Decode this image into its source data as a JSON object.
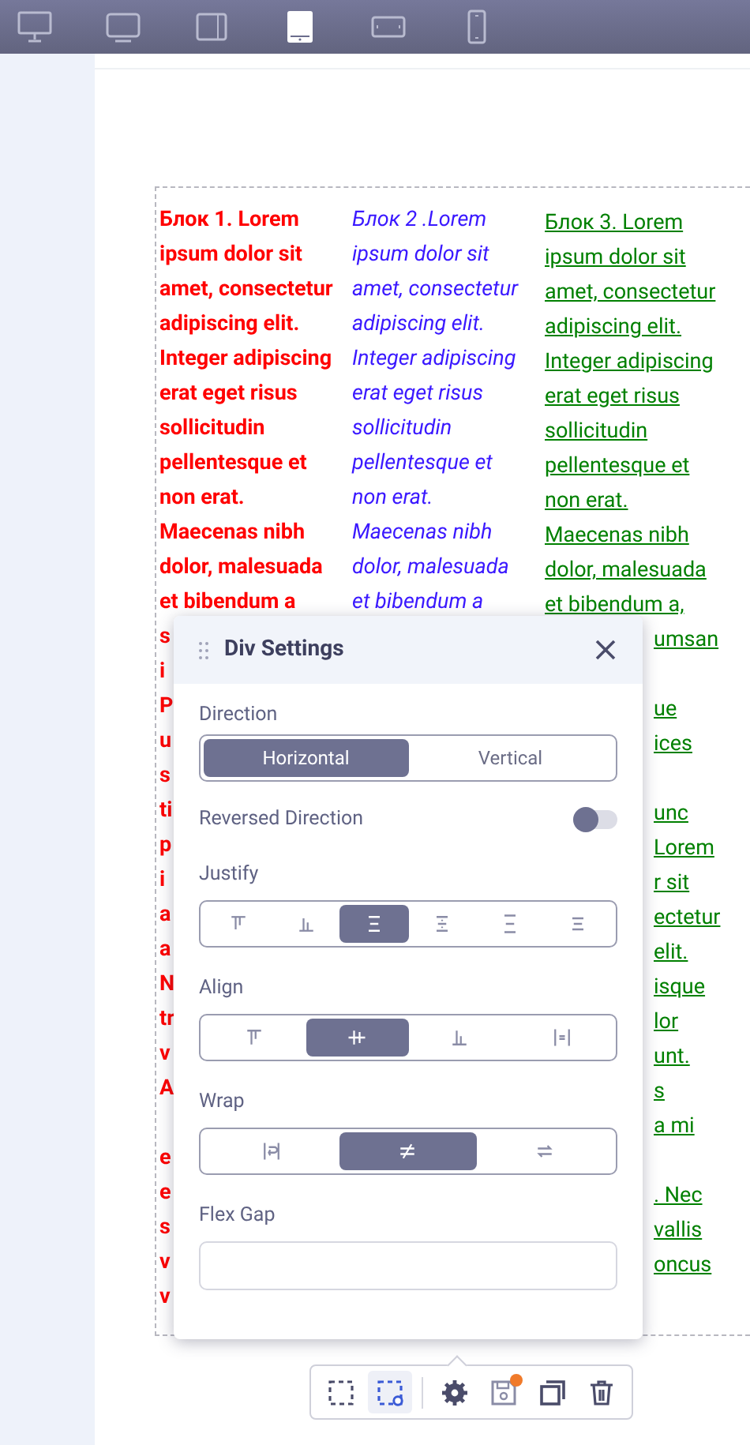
{
  "device_bar": [
    {
      "kind": "desktop",
      "selected": false
    },
    {
      "kind": "laptop",
      "selected": false
    },
    {
      "kind": "tablet-landscape",
      "selected": false
    },
    {
      "kind": "tablet-portrait",
      "selected": true
    },
    {
      "kind": "phone-landscape",
      "selected": false
    },
    {
      "kind": "phone-portrait",
      "selected": false
    }
  ],
  "blocks": [
    {
      "kind": "bold",
      "color": "#ff0000",
      "lines": [
        "Блок 1. Lorem",
        "ipsum dolor sit",
        "amet, consectetur",
        "adipiscing elit.",
        "Integer adipiscing",
        "erat eget risus",
        "sollicitudin",
        "pellentesque et",
        "non erat.",
        "Maecenas nibh",
        "dolor, malesuada",
        "et bibendum a"
      ],
      "visible_fragments": [
        [
          "s",
          "i",
          "P",
          "u",
          "s",
          "ti",
          "p",
          "i",
          "a",
          "a",
          "N",
          "tr",
          "v",
          "A"
        ],
        [
          "e",
          "e",
          "s",
          "v",
          "v"
        ]
      ]
    },
    {
      "kind": "italic",
      "color": "#3a18ff",
      "lines": [
        "Блок 2 .Lorem",
        "ipsum dolor sit",
        "amet, consectetur",
        "adipiscing elit.",
        "Integer adipiscing",
        "erat eget risus",
        "sollicitudin",
        "pellentesque et",
        "non erat.",
        "Maecenas nibh",
        "dolor, malesuada",
        "et bibendum a"
      ]
    },
    {
      "kind": "underline",
      "color": "#008000",
      "lines": [
        "Блок 3. Lorem",
        "ipsum dolor sit",
        "amet, consectetur",
        "adipiscing elit.",
        "Integer adipiscing",
        "erat eget risus",
        "sollicitudin",
        "pellentesque et",
        "non erat.",
        "Maecenas nibh",
        "dolor, malesuada",
        "et bibendum a,"
      ],
      "visible_fragments": [
        [
          "umsan"
        ],
        [
          "ue",
          "ices"
        ],
        [
          "unc",
          "Lorem",
          "r sit",
          "ectetur",
          "elit.",
          "isque",
          "lor",
          "unt.",
          "s",
          "a mi"
        ],
        [
          ". Nec",
          "vallis",
          "oncus"
        ]
      ]
    }
  ],
  "panel": {
    "title": "Div Settings",
    "direction": {
      "label": "Direction",
      "options": [
        {
          "label": "Horizontal",
          "selected": true
        },
        {
          "label": "Vertical",
          "selected": false
        }
      ]
    },
    "reversed_direction": {
      "label": "Reversed Direction",
      "on": false
    },
    "justify": {
      "label": "Justify",
      "options": [
        {
          "kind": "start",
          "selected": false
        },
        {
          "kind": "end",
          "selected": false
        },
        {
          "kind": "center",
          "selected": true
        },
        {
          "kind": "space-between",
          "selected": false
        },
        {
          "kind": "space-around",
          "selected": false
        },
        {
          "kind": "space-evenly",
          "selected": false
        }
      ]
    },
    "align": {
      "label": "Align",
      "options": [
        {
          "kind": "start",
          "selected": false
        },
        {
          "kind": "center",
          "selected": true
        },
        {
          "kind": "end",
          "selected": false
        },
        {
          "kind": "stretch",
          "selected": false
        }
      ]
    },
    "wrap": {
      "label": "Wrap",
      "options": [
        {
          "kind": "wrap",
          "selected": false
        },
        {
          "kind": "nowrap",
          "selected": true
        },
        {
          "kind": "wrap-reverse",
          "selected": false
        }
      ]
    },
    "flex_gap": {
      "label": "Flex Gap"
    }
  },
  "tool_groups": [
    [
      {
        "kind": "select",
        "selected": false,
        "badge": false
      },
      {
        "kind": "select-settings",
        "selected": true,
        "badge": false
      }
    ],
    [
      {
        "kind": "settings",
        "selected": false,
        "badge": false
      },
      {
        "kind": "save",
        "selected": false,
        "badge": true
      },
      {
        "kind": "copy",
        "selected": false,
        "badge": false
      },
      {
        "kind": "delete",
        "selected": false,
        "badge": false
      }
    ]
  ]
}
